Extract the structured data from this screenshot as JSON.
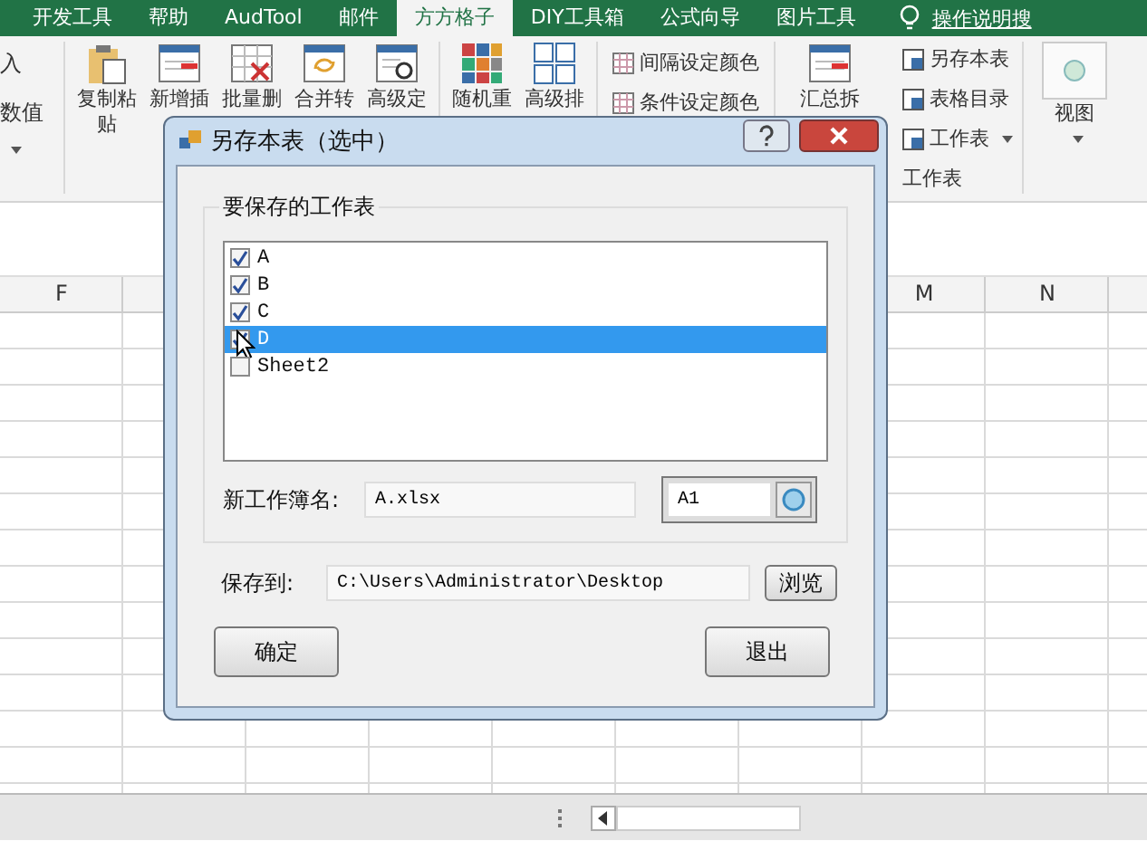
{
  "ribbon_tabs": [
    {
      "label": "开发工具",
      "selected": false
    },
    {
      "label": "帮助",
      "selected": false
    },
    {
      "label": "AudTool",
      "selected": false
    },
    {
      "label": "邮件",
      "selected": false
    },
    {
      "label": "方方格子",
      "selected": true
    },
    {
      "label": "DIY工具箱",
      "selected": false
    },
    {
      "label": "公式向导",
      "selected": false
    },
    {
      "label": "图片工具",
      "selected": false
    }
  ],
  "tell_me": "操作说明搜",
  "ribbon": {
    "left_labels": [
      "入",
      "数值"
    ],
    "large_buttons": [
      {
        "label": "复制粘",
        "sub": "贴",
        "kind": "paste"
      },
      {
        "label": "新增插",
        "kind": "insert"
      },
      {
        "label": "批量删",
        "kind": "delete"
      },
      {
        "label": "合并转",
        "kind": "merge"
      },
      {
        "label": "高级定",
        "kind": "find"
      },
      {
        "label": "随机重",
        "kind": "random"
      },
      {
        "label": "高级排",
        "kind": "sort"
      }
    ],
    "small_buttons": [
      "间隔设定颜色",
      "条件设定颜色"
    ],
    "summary_button": "汇总拆",
    "sheet_buttons": [
      {
        "label": "另存本表",
        "dropdown": false
      },
      {
        "label": "表格目录",
        "dropdown": false
      },
      {
        "label": "工作表",
        "dropdown": true
      }
    ],
    "group_label": "工作表",
    "view_button": "视图"
  },
  "column_headers": [
    "F",
    "M",
    "N"
  ],
  "dialog": {
    "title": "另存本表（选中）",
    "group_title": "要保存的工作表",
    "sheets": [
      {
        "name": "A",
        "checked": true,
        "selected": false
      },
      {
        "name": "B",
        "checked": true,
        "selected": false
      },
      {
        "name": "C",
        "checked": true,
        "selected": false
      },
      {
        "name": "D",
        "checked": true,
        "selected": true
      },
      {
        "name": "Sheet2",
        "checked": false,
        "selected": false
      }
    ],
    "workbook_label": "新工作簿名:",
    "workbook_value": "A.xlsx",
    "cell_value": "A1",
    "save_label": "保存到:",
    "save_value": "C:\\Users\\Administrator\\Desktop",
    "browse": "浏览",
    "ok": "确定",
    "exit": "退出"
  }
}
